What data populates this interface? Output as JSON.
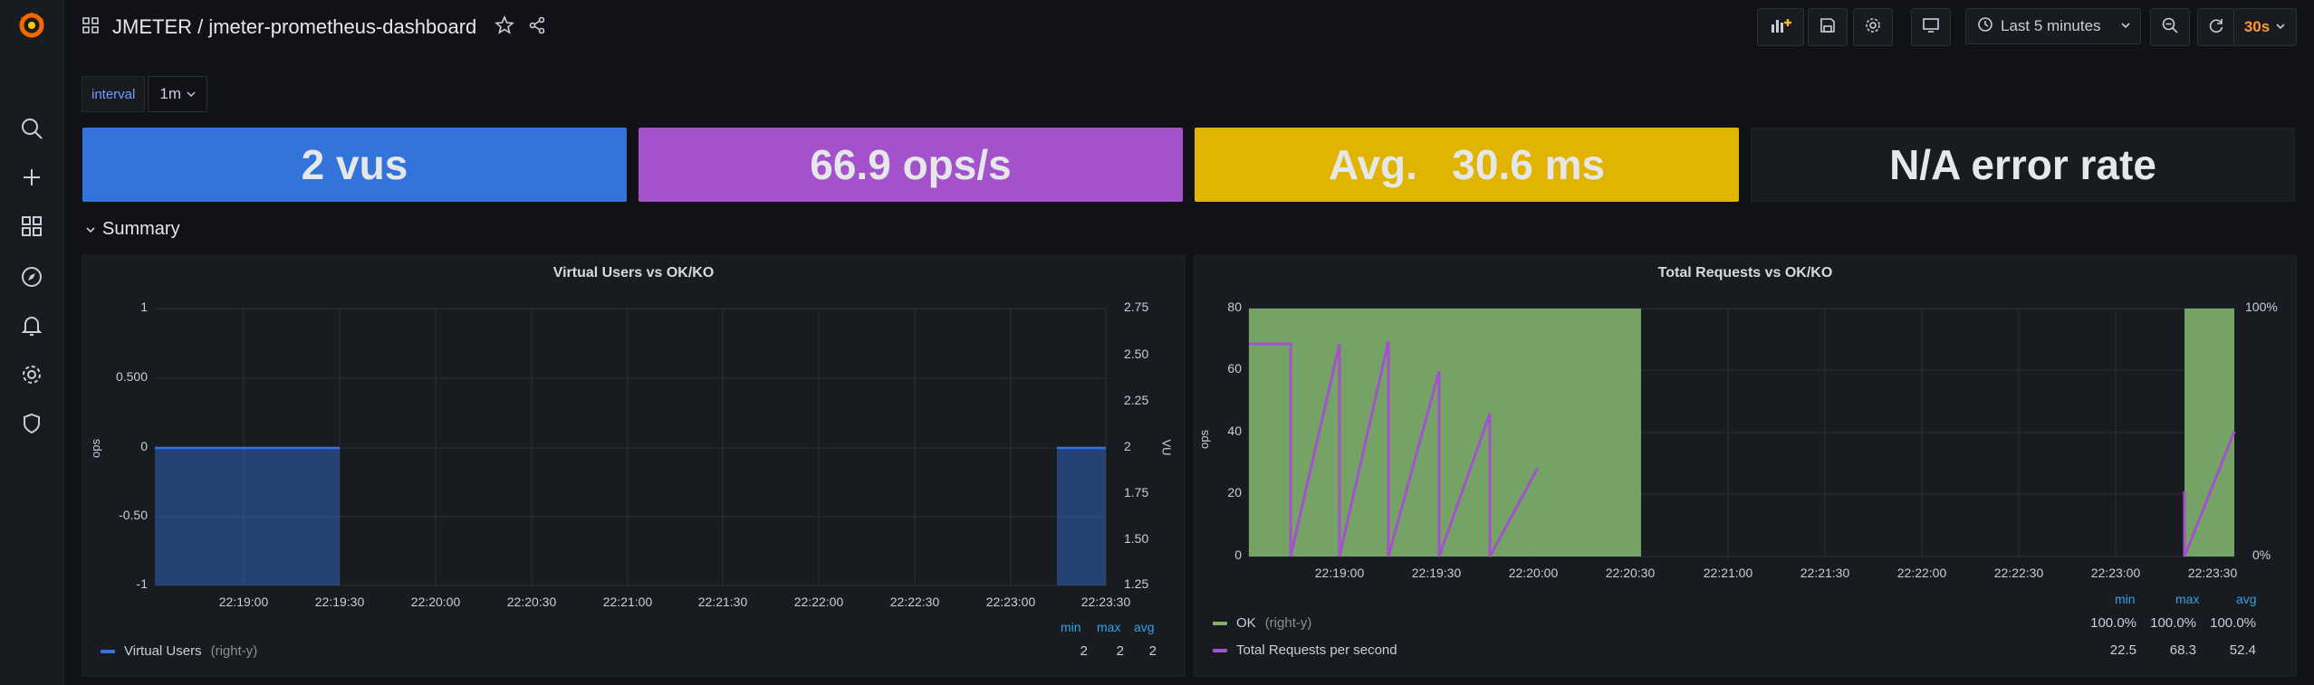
{
  "header": {
    "title": "JMETER / jmeter-prometheus-dashboard",
    "time_range": "Last 5 minutes",
    "refresh": "30s"
  },
  "variables": {
    "label": "interval",
    "value": "1m"
  },
  "stats": [
    {
      "text": "2 vus",
      "color": "#3274d9"
    },
    {
      "text": "66.9 ops/s",
      "color": "#a352cc"
    },
    {
      "text": "Avg.   30.6 ms",
      "color": "#e0b400"
    },
    {
      "text": "N/A error rate",
      "color": "#181b1f"
    }
  ],
  "row": {
    "title": "Summary"
  },
  "panels": {
    "left": {
      "title": "Virtual Users vs OK/KO",
      "y_left_title": "ops",
      "y_right_title": "VU",
      "y_left_ticks": [
        "1",
        "0.500",
        "0",
        "-0.50",
        "-1"
      ],
      "y_right_ticks": [
        "2.75",
        "2.50",
        "2.25",
        "2",
        "1.75",
        "1.50",
        "1.25"
      ],
      "x_ticks": [
        "22:19:00",
        "22:19:30",
        "22:20:00",
        "22:20:30",
        "22:21:00",
        "22:21:30",
        "22:22:00",
        "22:22:30",
        "22:23:00",
        "22:23:30"
      ],
      "legend_heads": {
        "min": "min",
        "max": "max",
        "avg": "avg"
      },
      "legend": [
        {
          "name": "Virtual Users",
          "axis": "(right-y)",
          "min": "2",
          "max": "2",
          "avg": "2",
          "color": "#3274d9"
        }
      ]
    },
    "right": {
      "title": "Total Requests vs OK/KO",
      "y_left_title": "ops",
      "y_left_ticks": [
        "80",
        "60",
        "40",
        "20",
        "0"
      ],
      "y_right_ticks": [
        "100%",
        "0%"
      ],
      "x_ticks": [
        "22:19:00",
        "22:19:30",
        "22:20:00",
        "22:20:30",
        "22:21:00",
        "22:21:30",
        "22:22:00",
        "22:22:30",
        "22:23:00",
        "22:23:30"
      ],
      "legend_heads": {
        "min": "min",
        "max": "max",
        "avg": "avg"
      },
      "legend": [
        {
          "name": "OK",
          "axis": "(right-y)",
          "min": "100.0%",
          "max": "100.0%",
          "avg": "100.0%",
          "color": "#7eb26d"
        },
        {
          "name": "Total Requests per second",
          "axis": "",
          "min": "22.5",
          "max": "68.3",
          "avg": "52.4",
          "color": "#a352cc"
        }
      ]
    }
  }
}
